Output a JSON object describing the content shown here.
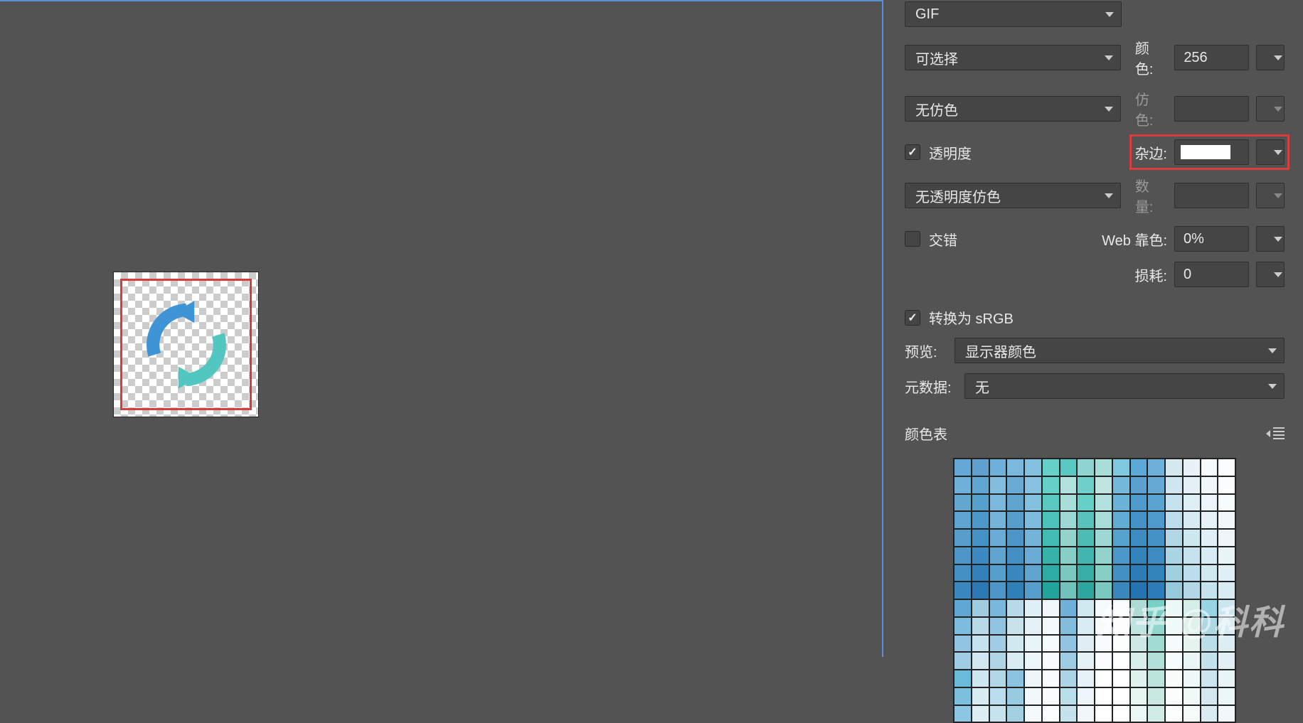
{
  "format_select": "GIF",
  "palette_select": "可选择",
  "dither_select": "无仿色",
  "transparency_dither_select": "无透明度仿色",
  "colors": {
    "label": "颜色:",
    "value": "256"
  },
  "dither_amount": {
    "label": "仿色:",
    "value": ""
  },
  "transparency": {
    "label": "透明度",
    "checked": true
  },
  "matte": {
    "label": "杂边:"
  },
  "amount": {
    "label": "数量:",
    "value": ""
  },
  "interlace": {
    "label": "交错",
    "checked": false
  },
  "web_snap": {
    "label": "Web 靠色:",
    "value": "0%"
  },
  "lossy": {
    "label": "损耗:",
    "value": "0"
  },
  "srgb": {
    "label": "转换为 sRGB",
    "checked": true
  },
  "preview": {
    "label": "预览:",
    "value": "显示器颜色"
  },
  "metadata": {
    "label": "元数据:",
    "value": "无"
  },
  "color_table_label": "颜色表",
  "watermark": "知乎 @科科",
  "swatches": [
    "#64a8d8",
    "#5fa0d0",
    "#6fb0da",
    "#7cb8dd",
    "#84c0e0",
    "#64d0c8",
    "#58c8c0",
    "#8ed4d0",
    "#a8ddd8",
    "#7ec8e0",
    "#5ea8d8",
    "#6fb0da",
    "#d5e8f0",
    "#e8f2f8",
    "#f5fafc",
    "#fafcfd",
    "#6fb0da",
    "#5ea8d0",
    "#82bdde",
    "#68aad4",
    "#88c2e0",
    "#64d0c8",
    "#b2e0dc",
    "#6ed0c8",
    "#c0e4e0",
    "#74b8dc",
    "#5aa0d0",
    "#64aad4",
    "#d0e6f0",
    "#e4f0f6",
    "#f0f7fb",
    "#fafcfd",
    "#64a8d0",
    "#56a0cc",
    "#7cb8dc",
    "#5ea4ce",
    "#84c0e0",
    "#58c8c0",
    "#a8ddd8",
    "#64d0c8",
    "#b2e0dc",
    "#6ab2d8",
    "#4e9acc",
    "#5aa4d0",
    "#c6e2ee",
    "#def0f4",
    "#ecf5fa",
    "#f6fbfc",
    "#5ea4d0",
    "#4c98ca",
    "#74b4da",
    "#589ecc",
    "#7ebcde",
    "#4cc2ba",
    "#9ed8d4",
    "#58c2bc",
    "#a8ddd8",
    "#60acd4",
    "#4492c8",
    "#4e9acc",
    "#bcdeec",
    "#d6ecf2",
    "#e6f2f8",
    "#f2f8fb",
    "#589eca",
    "#4492c6",
    "#6aacD6",
    "#4e96c8",
    "#74b4da",
    "#42bcb4",
    "#92d4cc",
    "#4cbcb4",
    "#9ed8d4",
    "#56a2ce",
    "#3c8cc2",
    "#4492c6",
    "#b2d8e8",
    "#cee8f0",
    "#e0f0f6",
    "#eef6fa",
    "#4e96c8",
    "#3c88c0",
    "#60a4d0",
    "#4490c4",
    "#6aacD6",
    "#36b4ac",
    "#86cec6",
    "#42b6ae",
    "#92d4cc",
    "#4c98ca",
    "#3484bc",
    "#3c8cc2",
    "#a8d4e4",
    "#c6e2ee",
    "#d8ecf4",
    "#e8f4f8",
    "#4490c4",
    "#3480ba",
    "#569ecc",
    "#3a88c0",
    "#60a4d0",
    "#2caca4",
    "#7ac8c0",
    "#36aea6",
    "#86cec6",
    "#4290c4",
    "#2c7cb8",
    "#3484bc",
    "#9ed0e0",
    "#bcdeec",
    "#d0e8f0",
    "#e0f0f6",
    "#3a88c0",
    "#2c78b4",
    "#4e96c8",
    "#3080b8",
    "#569ecc",
    "#22a49c",
    "#70c2ba",
    "#2ca69e",
    "#7ac8c0",
    "#3888be",
    "#2474b2",
    "#2c7cb8",
    "#94cadc",
    "#b2d8e8",
    "#c6e2ee",
    "#d8ecf4",
    "#60a8d4",
    "#a0cce0",
    "#78b8dc",
    "#b8dae8",
    "#dff0f6",
    "#f0f8fb",
    "#6fb0da",
    "#d0e8f0",
    "#f5fafc",
    "#fafcfd",
    "#b0dad4",
    "#7ad0c6",
    "#ecf8f6",
    "#d6eee8",
    "#99d4e4",
    "#cce6f0",
    "#7cbcde",
    "#b8dae8",
    "#90c4e2",
    "#c8e2ec",
    "#e4f2f8",
    "#f4fafc",
    "#82bdde",
    "#d8ecf4",
    "#f6fbfc",
    "#fcfdfe",
    "#c0e4e0",
    "#90d6cc",
    "#f0faf8",
    "#e0f2ee",
    "#aed8e4",
    "#d6ecf2",
    "#90c4e2",
    "#c6e2ee",
    "#a0cce4",
    "#d2e8f0",
    "#e8f4f8",
    "#f6fbfc",
    "#90c4e0",
    "#deeef4",
    "#f8fcfd",
    "#fcfefe",
    "#cee8e4",
    "#a0dcd4",
    "#f4fbfa",
    "#e6f4f0",
    "#badeea",
    "#dceef4",
    "#a0cce4",
    "#d2e8f0",
    "#aed4e6",
    "#d8ecf2",
    "#ecf5fa",
    "#f8fcfd",
    "#9eccE4",
    "#e4f2f6",
    "#fafcfe",
    "#fdfefe",
    "#d8eeea",
    "#b0e0d8",
    "#f6fcfb",
    "#eaf6f4",
    "#c4e2ec",
    "#e2f0f6",
    "#6abadc",
    "#cee8f0",
    "#b2d8e8",
    "#8ac2e0",
    "#eef6fa",
    "#f8fcfd",
    "#acD4e6",
    "#e6f2f8",
    "#fff",
    "#fff",
    "#e0f2ee",
    "#bce4dc",
    "#f8fdfc",
    "#eef8f6",
    "#cce6f0",
    "#e8f4f8",
    "#7cc0de",
    "#d6ecf2",
    "#bcdeec",
    "#98cae2",
    "#f2f8fb",
    "#fafcfd",
    "#badeea",
    "#ecf5fa",
    "#fff",
    "#fff",
    "#e8f6f2",
    "#c8e8e0",
    "#fafdfc",
    "#f2faf8",
    "#d4e8f0",
    "#ecf5fa",
    "#8cc6e2",
    "#dceef4",
    "#c6e2ee",
    "#a4d0e4",
    "#f4fafc",
    "#fcfdfe",
    "#c4e2ec",
    "#f0f7fb",
    "#fff",
    "#fff",
    "#ecf8f6",
    "#d0ece4",
    "#fcfefd",
    "#f6fcfa",
    "#daecF2",
    "#f0f8fb"
  ]
}
